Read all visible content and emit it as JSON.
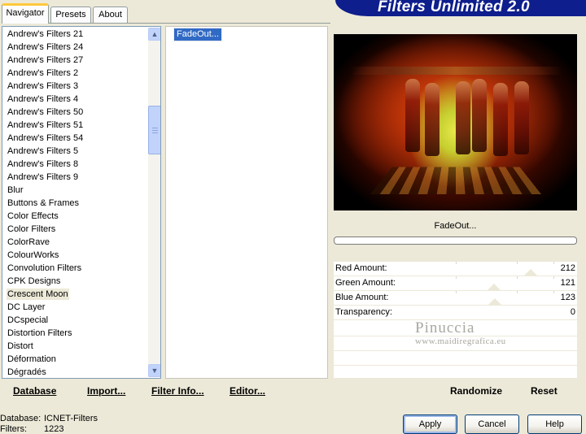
{
  "tabs": [
    {
      "label": "Navigator"
    },
    {
      "label": "Presets"
    },
    {
      "label": "About"
    }
  ],
  "banner": {
    "title": "Filters Unlimited 2.0"
  },
  "categories": [
    "Andrew's Filters 21",
    "Andrew's Filters 24",
    "Andrew's Filters 27",
    "Andrew's Filters 2",
    "Andrew's Filters 3",
    "Andrew's Filters 4",
    "Andrew's Filters 50",
    "Andrew's Filters 51",
    "Andrew's Filters 54",
    "Andrew's Filters 5",
    "Andrew's Filters 8",
    "Andrew's Filters 9",
    "Blur",
    "Buttons & Frames",
    "Color Effects",
    "Color Filters",
    "ColorRave",
    "ColourWorks",
    "Convolution Filters",
    "CPK Designs",
    "Crescent Moon",
    "DC Layer",
    "DCspecial",
    "Distortion Filters",
    "Distort",
    "Déformation",
    "Dégradés"
  ],
  "selected_category": "Crescent Moon",
  "filters": [
    "FadeOut..."
  ],
  "selected_filter": "FadeOut...",
  "filter_name": "FadeOut...",
  "params": [
    {
      "label": "Red Amount:",
      "value": "212",
      "level": 212
    },
    {
      "label": "Green Amount:",
      "value": "121",
      "level": 121
    },
    {
      "label": "Blue Amount:",
      "value": "123",
      "level": 123
    },
    {
      "label": "Transparency:",
      "value": "0",
      "level": 0
    }
  ],
  "watermark": {
    "line1": "Pinuccia",
    "line2": "www.maidiregrafica.eu"
  },
  "links": {
    "database": "Database",
    "import": "Import...",
    "filter_info": "Filter Info...",
    "editor": "Editor...",
    "randomize": "Randomize",
    "reset": "Reset"
  },
  "status": {
    "database_label": "Database:",
    "database_value": "ICNET-Filters",
    "filters_label": "Filters:",
    "filters_value": "1223"
  },
  "buttons": {
    "apply": "Apply",
    "cancel": "Cancel",
    "help": "Help"
  },
  "scroll": {
    "up_icon": "arrow-up",
    "down_icon": "arrow-down"
  }
}
